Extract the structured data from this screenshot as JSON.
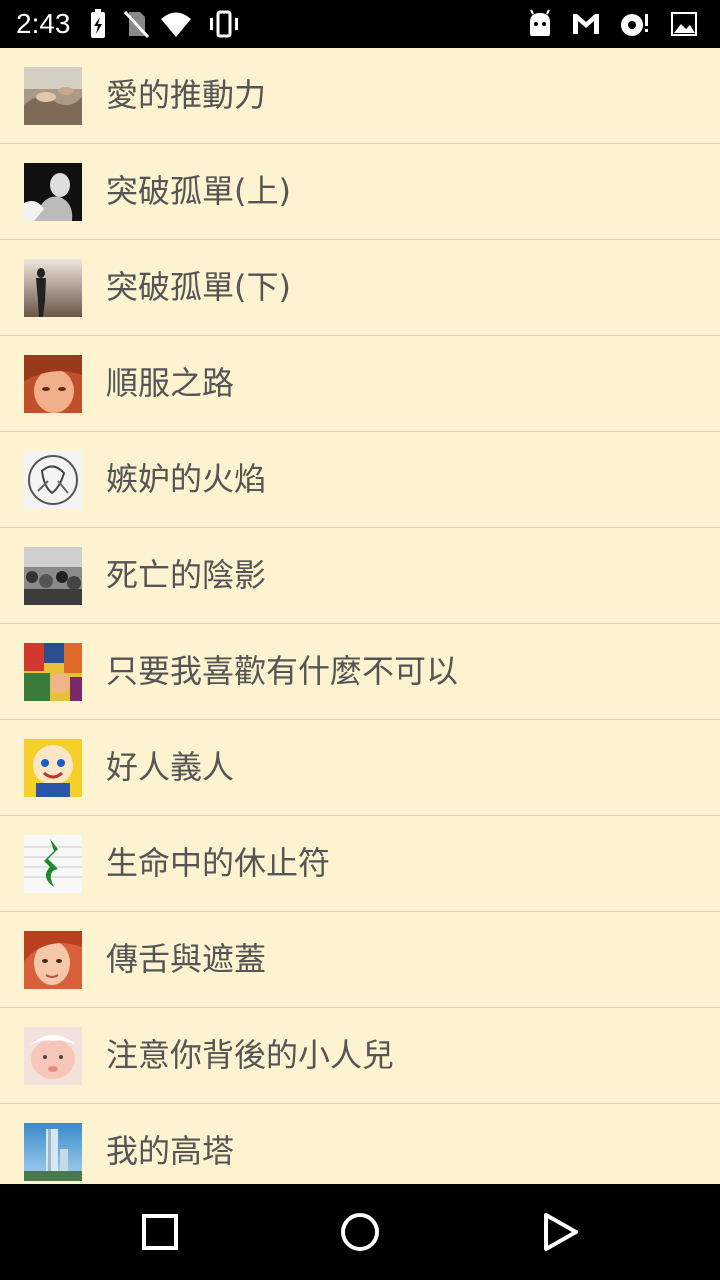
{
  "status_bar": {
    "time": "2:43",
    "icons": [
      "battery-charging-icon",
      "no-sim-icon",
      "wifi-icon",
      "vibrate-icon",
      "android-icon",
      "gmail-icon",
      "sync-alert-icon",
      "image-icon"
    ]
  },
  "list": {
    "items": [
      {
        "label": "愛的推動力",
        "thumb": "fresco-thumbnail"
      },
      {
        "label": "突破孤單(上)",
        "thumb": "lonely-person-thumbnail"
      },
      {
        "label": "突破孤單(下)",
        "thumb": "silhouette-thumbnail"
      },
      {
        "label": "順服之路",
        "thumb": "face-thumbnail"
      },
      {
        "label": "嫉妒的火焰",
        "thumb": "sketch-thumbnail"
      },
      {
        "label": "死亡的陰影",
        "thumb": "crowd-thumbnail"
      },
      {
        "label": "只要我喜歡有什麼不可以",
        "thumb": "collage-thumbnail"
      },
      {
        "label": "好人義人",
        "thumb": "cartoon-thumbnail"
      },
      {
        "label": "生命中的休止符",
        "thumb": "music-rest-thumbnail"
      },
      {
        "label": "傳舌與遮蓋",
        "thumb": "girl-thumbnail"
      },
      {
        "label": "注意你背後的小人兒",
        "thumb": "baby-thumbnail"
      },
      {
        "label": "我的高塔",
        "thumb": "tower-thumbnail"
      }
    ]
  },
  "nav_bar": {
    "buttons": [
      "recents-button",
      "home-button",
      "back-button"
    ]
  }
}
